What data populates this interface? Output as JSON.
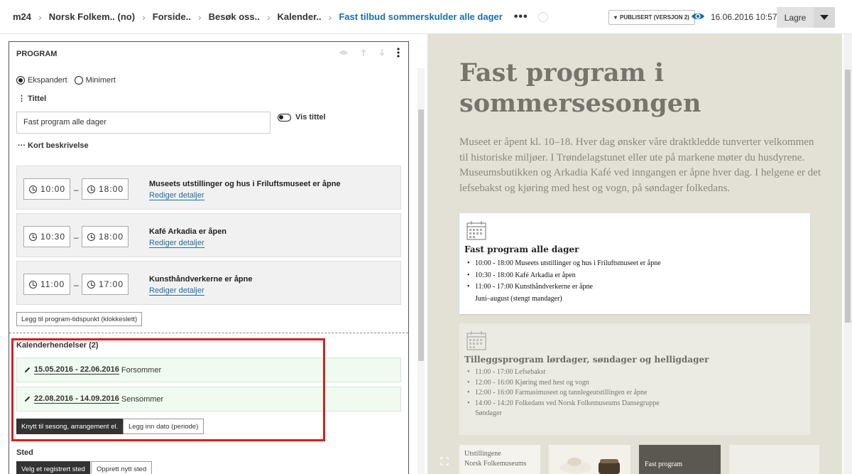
{
  "breadcrumbs": {
    "items": [
      "m24",
      "Norsk Folkem.. (no)",
      "Forside..",
      "Besøk oss..",
      "Kalender..",
      "Fast tilbud sommerskulder alle dager"
    ]
  },
  "header": {
    "status_label": "PUBLISERT (VERSJON 2)",
    "datetime": "16.06.2016 10:57",
    "save_label": "Lagre"
  },
  "editor": {
    "section_title": "PROGRAM",
    "view_options": [
      "Ekspandert",
      "Minimert"
    ],
    "selected_view": "Ekspandert",
    "title_label": "Tittel",
    "title_value": "Fast program alle dager",
    "show_title_label": "Vis tittel",
    "short_desc_label": "Kort beskrivelse",
    "program_items": [
      {
        "start": "10:00",
        "end": "18:00",
        "title": "Museets utstillinger og hus i Friluftsmuseet er åpne",
        "link": "Rediger detaljer"
      },
      {
        "start": "10:30",
        "end": "18:00",
        "title": "Kafé Arkadia er åpen",
        "link": "Rediger detaljer"
      },
      {
        "start": "11:00",
        "end": "17:00",
        "title": "Kunsthåndverkerne er åpne",
        "link": "Rediger detaljer"
      }
    ],
    "dash": "–",
    "add_program_label": "Legg til program-tidspunkt (klokkeslett)",
    "calendar_heading": "Kalenderhendelser (2)",
    "calendar_events": [
      {
        "dates": "15.05.2016 - 22.06.2016",
        "name": "Forsommer"
      },
      {
        "dates": "22.08.2016 - 14.09.2016",
        "name": "Sensommer"
      }
    ],
    "link_season_label": "Knytt til sesong, arrangement el.",
    "add_date_label": "Legg inn dato (periode)",
    "place_label": "Sted",
    "choose_place_label": "Velg et registrert sted",
    "create_place_label": "Opprett nytt sted"
  },
  "preview": {
    "title": "Fast program i sommersesongen",
    "intro": "Museet er åpent kl. 10–18. Hver dag ønsker våre draktkledde tunverter velkommen til historiske miljøer. I Trøndelagstunet eller ute på markene møter du husdyrene. Museumsbutikken og Arkadia Kafé ved inngangen er åpne hver dag. I helgene er det lefsebakst og kjøring med hest og vogn, på søndager folkedans.",
    "card1": {
      "title": "Fast program alle dager",
      "items": [
        "10:00 - 18:00 Museets utstillinger og hus i Friluftsmuseet er åpne",
        "10:30 - 18:00 Kafé Arkadia er åpen",
        "11:00 - 17:00 Kunsthåndverkerne er åpne"
      ],
      "note": "Juni–august (stengt mandager)"
    },
    "card2": {
      "title": "Tilleggsprogram lørdager, søndager og helligdager",
      "items": [
        "11:00 - 17:00 Lefsebakst",
        "12:00 - 16:00 Kjøring med hest og vogn",
        "12:00 - 16:00 Farmasimuseet og tannlegeutstillingen er åpne",
        "14:00 - 14:20 Folkedans ved Norsk Folkemuseums Dansegruppe"
      ],
      "note": "Søndager"
    },
    "tiles": {
      "t1_title": "Utstillingene",
      "t1_sub": "Norsk Folkemuseums",
      "t3_title": "Fast program"
    }
  },
  "colors": {
    "accent": "#1c6fa8",
    "highlight": "#d42020",
    "preview_bg": "#e3e1d5"
  }
}
